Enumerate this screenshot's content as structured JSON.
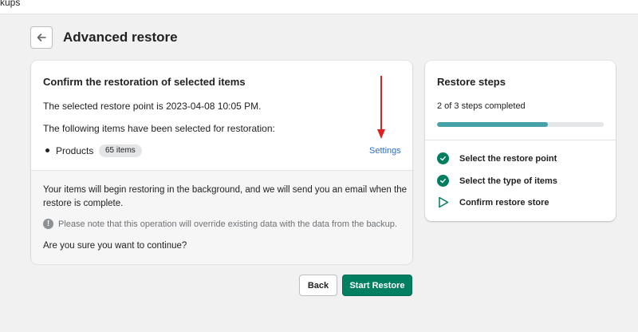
{
  "topbar": {
    "crumb": "kups"
  },
  "header": {
    "title": "Advanced restore",
    "back_icon": "arrow-left-icon"
  },
  "confirm_card": {
    "title": "Confirm the restoration of selected items",
    "restore_point_text": "The selected restore point is 2023-04-08 10:05 PM.",
    "items_intro": "The following items have been selected for restoration:",
    "items": [
      {
        "label": "Products",
        "count_badge": "65 items"
      }
    ],
    "settings_link": "Settings",
    "background_note": "Your items will begin restoring in the background, and we will send you an email when the",
    "background_note_cont": "restore is complete.",
    "warning_icon": "exclamation-circle-icon",
    "warning_text": "Please note that this operation will override existing data with the data from the backup.",
    "confirm_question": "Are you sure you want to continue?"
  },
  "annotation": {
    "color": "#e02020",
    "icon": "red-arrow-down-icon"
  },
  "steps_card": {
    "title": "Restore steps",
    "progress_text": "2 of 3 steps completed",
    "progress_fraction": 0.667,
    "progress_color": "#47a1a8",
    "steps": [
      {
        "label": "Select the restore point",
        "status": "complete",
        "icon": "check-circle-icon"
      },
      {
        "label": "Select the type of items",
        "status": "complete",
        "icon": "check-circle-icon"
      },
      {
        "label": "Confirm restore store",
        "status": "current",
        "icon": "play-outline-icon"
      }
    ]
  },
  "footer": {
    "back_label": "Back",
    "primary_label": "Start Restore",
    "primary_color": "#008060"
  }
}
